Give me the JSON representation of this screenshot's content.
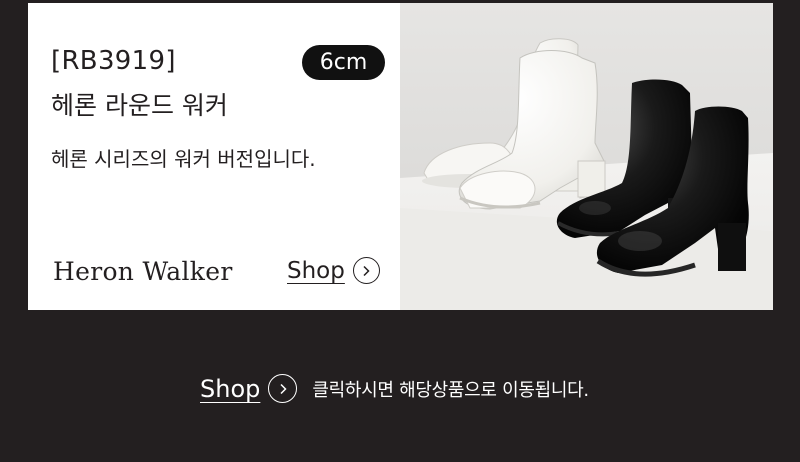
{
  "product": {
    "code": "[RB3919]",
    "name": "헤론 라운드 워커",
    "description": "헤론 시리즈의 워커 버전입니다.",
    "heel_badge": "6cm",
    "series": "Heron Walker",
    "shop_label": "Shop",
    "shop_icon": "chevron-right-circle-icon"
  },
  "footer": {
    "shop_label": "Shop",
    "shop_icon": "chevron-right-circle-icon",
    "note": "클릭하시면 해당상품으로 이동됩니다."
  },
  "colors": {
    "background": "#231f20",
    "card": "#ffffff",
    "badge": "#111111"
  }
}
